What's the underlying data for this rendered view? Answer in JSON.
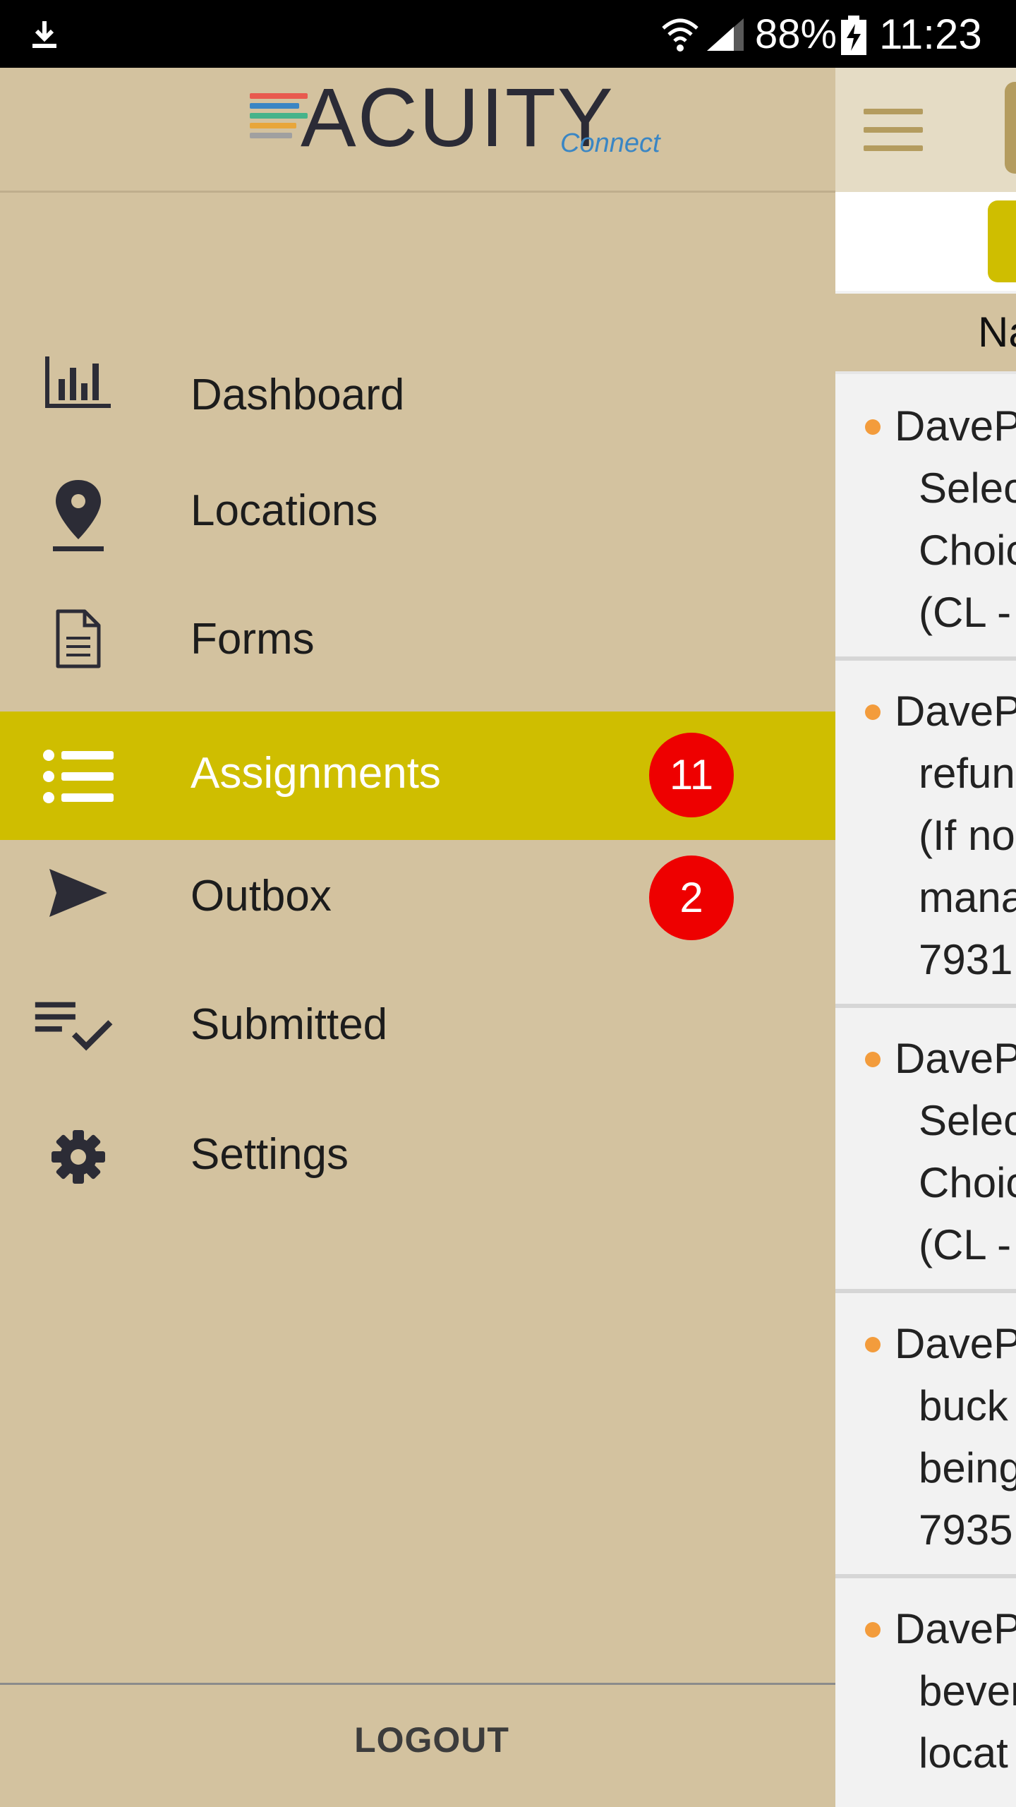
{
  "status_bar": {
    "battery_percent": "88%",
    "time": "11:23",
    "icons": [
      "download-icon",
      "wifi-icon",
      "signal-icon",
      "battery-charging-icon"
    ]
  },
  "logo": {
    "word": "ACUITY",
    "sub": "Connect"
  },
  "menu": [
    {
      "label": "Dashboard",
      "icon": "bar-chart-icon"
    },
    {
      "label": "Locations",
      "icon": "location-pin-icon"
    },
    {
      "label": "Forms",
      "icon": "document-icon"
    },
    {
      "label": "Assignments",
      "icon": "list-icon",
      "badge": "11",
      "active": true
    },
    {
      "label": "Outbox",
      "icon": "send-icon",
      "badge": "2"
    },
    {
      "label": "Submitted",
      "icon": "checklist-icon"
    },
    {
      "label": "Settings",
      "icon": "gear-icon"
    }
  ],
  "logout_label": "LOGOUT",
  "behind": {
    "header": "Na",
    "items": [
      [
        "DaveP",
        "Selec",
        "Choic",
        "(CL -"
      ],
      [
        "DaveP",
        "refun",
        "(If no",
        "mana",
        "7931"
      ],
      [
        "DaveP",
        "Selec",
        "Choic",
        "(CL -"
      ],
      [
        "DaveP",
        "buck",
        "being",
        "7935"
      ],
      [
        "DaveP",
        "bever",
        "locat"
      ]
    ]
  },
  "colors": {
    "drawer_bg": "#d3c29f",
    "active_bg": "#cfbe00",
    "badge": "#ee0000",
    "bullet": "#f39c3c"
  }
}
